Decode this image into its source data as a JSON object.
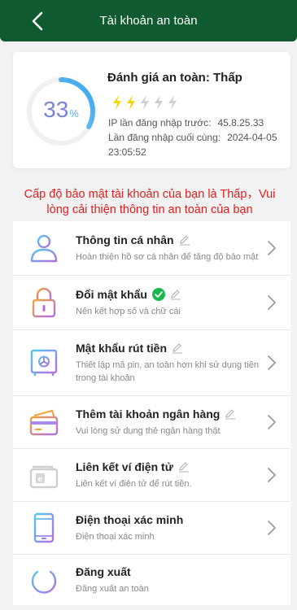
{
  "header": {
    "title": "Tài khoản an toàn"
  },
  "safety": {
    "score_value": "33",
    "score_unit": "%",
    "score_fraction": 0.33,
    "rating_label": "Đánh giá an toàn: Thấp",
    "level_total": 5,
    "level_filled": 2,
    "ip_label": "IP lần đăng nhập trước:",
    "ip_value": "45.8.25.33",
    "last_login_label": "Lần đăng nhập cuối cùng:",
    "last_login_date": "2024-04-05",
    "last_login_time": "23:05:52"
  },
  "warning": "Cấp độ bảo mật tài khoản của bạn là Thấp，Vui lòng cải thiện thông tin an toàn của bạn",
  "colors": {
    "header": "#0f5a2f",
    "warning": "#e02020",
    "check": "#19b84a",
    "bolt_on": "#f5d800",
    "bolt_off": "#cfcfcf"
  },
  "menu": [
    {
      "label": "Thông tin cá nhân",
      "desc": "Hoàn thiện hồ sơ cá nhân để tăng độ bảo mật",
      "icon": "user-icon",
      "verified": false
    },
    {
      "label": "Đổi mật khẩu",
      "desc": "Nên kết hợp số và chữ cái",
      "icon": "lock-icon",
      "verified": true
    },
    {
      "label": "Mật khẩu rút tiền",
      "desc": "Thiết lập mã pin, an toàn hơn khi sử dụng tiền trong tài khoản",
      "icon": "safe-icon",
      "verified": false
    },
    {
      "label": "Thêm tài khoản ngân hàng",
      "desc": "Vui lòng sử dụng thẻ ngân hàng thật",
      "icon": "bank-card-icon",
      "verified": false
    },
    {
      "label": "Liên kết ví điện tử",
      "desc": "Liên kết ví điện tử để rút tiền.",
      "icon": "e-wallet-icon",
      "verified": false
    },
    {
      "label": "Điện thoại xác minh",
      "desc": "Điện thoại xác minh",
      "icon": "phone-icon",
      "verified": false
    },
    {
      "label": "Đăng xuất",
      "desc": "Đăng xuất an toàn",
      "icon": "power-icon",
      "verified": false
    }
  ]
}
